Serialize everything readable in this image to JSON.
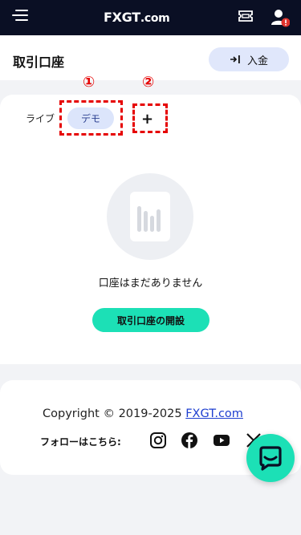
{
  "topbar": {
    "logo": "FXGT",
    "logo_suffix": ".com",
    "menu_icon": "hamburger-icon",
    "ticket_icon": "ticket-icon",
    "user_icon": "user-icon",
    "alert_badge": "!",
    "badge_color": "#e0332d"
  },
  "header": {
    "title": "取引口座",
    "deposit_label": "入金"
  },
  "tabs": {
    "live": "ライブ",
    "demo": "デモ",
    "add": "+"
  },
  "annotations": {
    "marker_1": "①",
    "marker_2": "②",
    "color": "#e60000"
  },
  "empty_state": {
    "message": "口座はまだありません",
    "open_account_label": "取引口座の開設"
  },
  "footer": {
    "copyright_prefix": "Copyright © 2019-2025 ",
    "copyright_link": "FXGT.com",
    "follow_label": "フォローはこちら:",
    "social": [
      "instagram-icon",
      "facebook-icon",
      "youtube-icon",
      "x-icon"
    ]
  },
  "colors": {
    "accent": "#1ce0b6",
    "navy": "#0a0f24",
    "chip": "#dce5fb"
  }
}
